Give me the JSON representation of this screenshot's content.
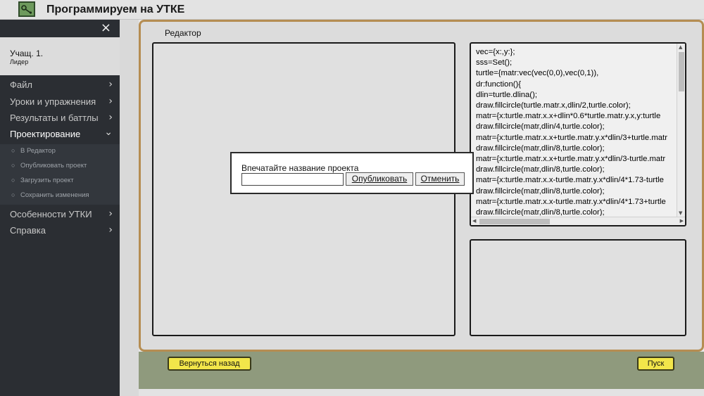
{
  "app": {
    "title": "Программируем на УТКЕ",
    "logo_icon": "turtle-logo-icon"
  },
  "sidebar": {
    "close_symbol": "×",
    "user": {
      "name": "Учащ. 1.",
      "role": "Лидер"
    },
    "menu": [
      {
        "label": "Файл",
        "chevron": "›"
      },
      {
        "label": "Уроки и упражнения",
        "chevron": "›"
      },
      {
        "label": "Результаты и баттлы",
        "chevron": "›"
      },
      {
        "label": "Проектирование",
        "chevron": "⌄",
        "expanded": true
      },
      {
        "label": "Особенности УТКИ",
        "chevron": "›"
      },
      {
        "label": "Справка",
        "chevron": "›"
      }
    ],
    "submenu": [
      {
        "label": "В Редактор",
        "bullet": "○"
      },
      {
        "label": "Опубликовать проект",
        "bullet": "○"
      },
      {
        "label": "Загрузить проект",
        "bullet": "○"
      },
      {
        "label": "Сохранить изменения",
        "bullet": "○"
      }
    ]
  },
  "editor": {
    "title": "Редактор",
    "code": "vec={x:,y:};\nsss=Set();\nturtle={matr:vec(vec(0,0),vec(0,1)),\ndr:function(){\ndlin=turtle.dlina();\ndraw.fillcircle(turtle.matr.x,dlin/2,turtle.color);\nmatr={x:turtle.matr.x.x+dlin*0.6*turtle.matr.y.x,y:turtle\ndraw.fillcircle(matr,dlin/4,turtle.color);\nmatr={x:turtle.matr.x.x+turtle.matr.y.x*dlin/3+turtle.matr\ndraw.fillcircle(matr,dlin/8,turtle.color);\nmatr={x:turtle.matr.x.x+turtle.matr.y.x*dlin/3-turtle.matr\ndraw.fillcircle(matr,dlin/8,turtle.color);\nmatr={x:turtle.matr.x.x-turtle.matr.y.x*dlin/4*1.73-turtle\ndraw.fillcircle(matr,dlin/8,turtle.color);\nmatr={x:turtle.matr.x.x-turtle.matr.y.x*dlin/4*1.73+turtle\ndraw.fillcircle(matr,dlin/8,turtle.color);",
    "back_button": "Вернуться назад",
    "run_button": "Пуск"
  },
  "dialog": {
    "prompt": "Впечатайте название проекта",
    "input_value": "",
    "publish_button": "Опубликовать",
    "cancel_button": "Отменить"
  },
  "colors": {
    "sidebar_bg": "#2b2e33",
    "panel_border": "#b58d52",
    "button_yellow": "#f2e64a",
    "bottom_bar": "#8f9a7d"
  }
}
